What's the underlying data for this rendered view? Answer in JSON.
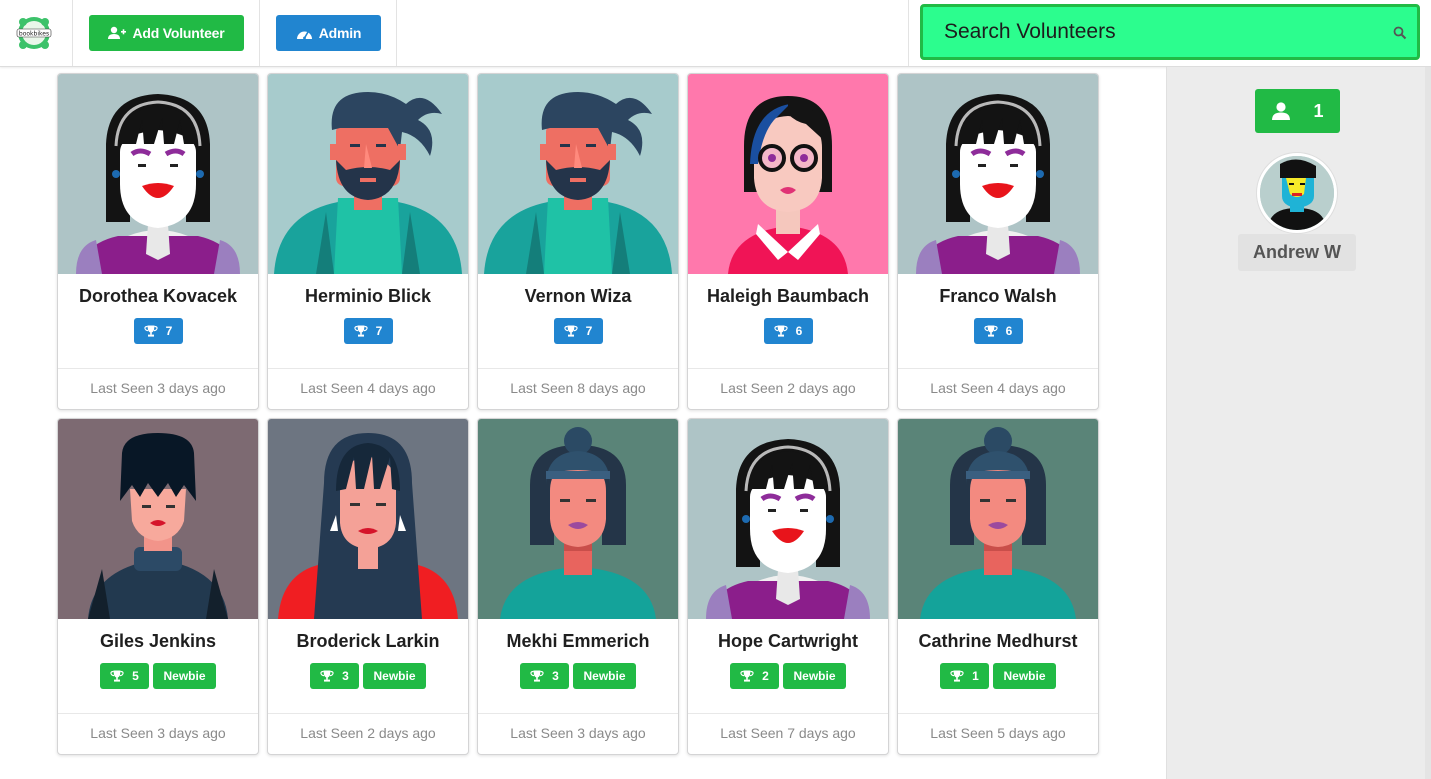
{
  "topbar": {
    "logo": "bookbikes-logo",
    "add_volunteer": "Add Volunteer",
    "admin": "Admin",
    "search_placeholder": "Search Volunteers"
  },
  "sidebar": {
    "active_count": "1",
    "user_name": "Andrew W"
  },
  "colors": {
    "green": "#21ba45",
    "blue": "#2185d0",
    "search_bg": "#2cfd8e"
  },
  "volunteers": [
    {
      "name": "Dorothea Kovacek",
      "trophies": "7",
      "newbie": false,
      "last_seen": "Last Seen 3 days ago",
      "avatar": "woman-bangs-headband"
    },
    {
      "name": "Herminio Blick",
      "trophies": "7",
      "newbie": false,
      "last_seen": "Last Seen 4 days ago",
      "avatar": "bearded-man"
    },
    {
      "name": "Vernon Wiza",
      "trophies": "7",
      "newbie": false,
      "last_seen": "Last Seen 8 days ago",
      "avatar": "bearded-man"
    },
    {
      "name": "Haleigh Baumbach",
      "trophies": "6",
      "newbie": false,
      "last_seen": "Last Seen 2 days ago",
      "avatar": "woman-glasses"
    },
    {
      "name": "Franco Walsh",
      "trophies": "6",
      "newbie": false,
      "last_seen": "Last Seen 4 days ago",
      "avatar": "woman-bangs-headband"
    },
    {
      "name": "Giles Jenkins",
      "trophies": "5",
      "newbie": true,
      "newbie_label": "Newbie",
      "last_seen": "Last Seen 3 days ago",
      "avatar": "man-turtleneck"
    },
    {
      "name": "Broderick Larkin",
      "trophies": "3",
      "newbie": true,
      "newbie_label": "Newbie",
      "last_seen": "Last Seen 2 days ago",
      "avatar": "woman-long-hair"
    },
    {
      "name": "Mekhi Emmerich",
      "trophies": "3",
      "newbie": true,
      "newbie_label": "Newbie",
      "last_seen": "Last Seen 3 days ago",
      "avatar": "woman-bun"
    },
    {
      "name": "Hope Cartwright",
      "trophies": "2",
      "newbie": true,
      "newbie_label": "Newbie",
      "last_seen": "Last Seen 7 days ago",
      "avatar": "woman-bangs-headband"
    },
    {
      "name": "Cathrine Medhurst",
      "trophies": "1",
      "newbie": true,
      "newbie_label": "Newbie",
      "last_seen": "Last Seen 5 days ago",
      "avatar": "woman-bun"
    }
  ]
}
